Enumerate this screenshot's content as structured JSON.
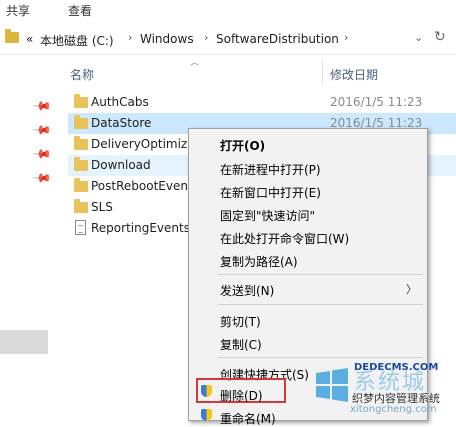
{
  "ribbon": {
    "tabs": [
      "共享",
      "查看"
    ]
  },
  "address": {
    "crumbs": [
      "本地磁盘 (C:)",
      "Windows",
      "SoftwareDistribution"
    ],
    "lead": "«"
  },
  "columns": {
    "name": "名称",
    "date": "修改日期"
  },
  "files": [
    {
      "name": "AuthCabs",
      "date": "2016/1/5 11:23",
      "type": "folder"
    },
    {
      "name": "DataStore",
      "date": "2016/1/5 11:23",
      "type": "folder",
      "state": "selected"
    },
    {
      "name": "DeliveryOptimization",
      "date": "",
      "type": "folder"
    },
    {
      "name": "Download",
      "date": "",
      "type": "folder",
      "state": "hover"
    },
    {
      "name": "PostRebootEventCache",
      "date": "",
      "type": "folder"
    },
    {
      "name": "SLS",
      "date": "",
      "type": "folder"
    },
    {
      "name": "ReportingEvents",
      "date": "",
      "type": "file"
    }
  ],
  "context_menu": {
    "open": "打开(O)",
    "open_new_process": "在新进程中打开(P)",
    "open_new_window": "在新窗口中打开(E)",
    "pin_quick_access": "固定到\"快速访问\"",
    "open_cmd_here": "在此处打开命令窗口(W)",
    "copy_as_path": "复制为路径(A)",
    "send_to": "发送到(N)",
    "cut": "剪切(T)",
    "copy": "复制(C)",
    "create_shortcut": "创建快捷方式(S)",
    "delete": "删除(D)",
    "rename": "重命名(M)"
  },
  "watermark": {
    "brand": "系统城",
    "site": "xitongcheng.com",
    "dede": "DEDECMS.COM",
    "dede_cn": "织梦内容管理系统"
  },
  "colors": {
    "selection": "#cce8ff",
    "hover": "#e5f3ff",
    "highlight_border": "#d13a3a"
  }
}
